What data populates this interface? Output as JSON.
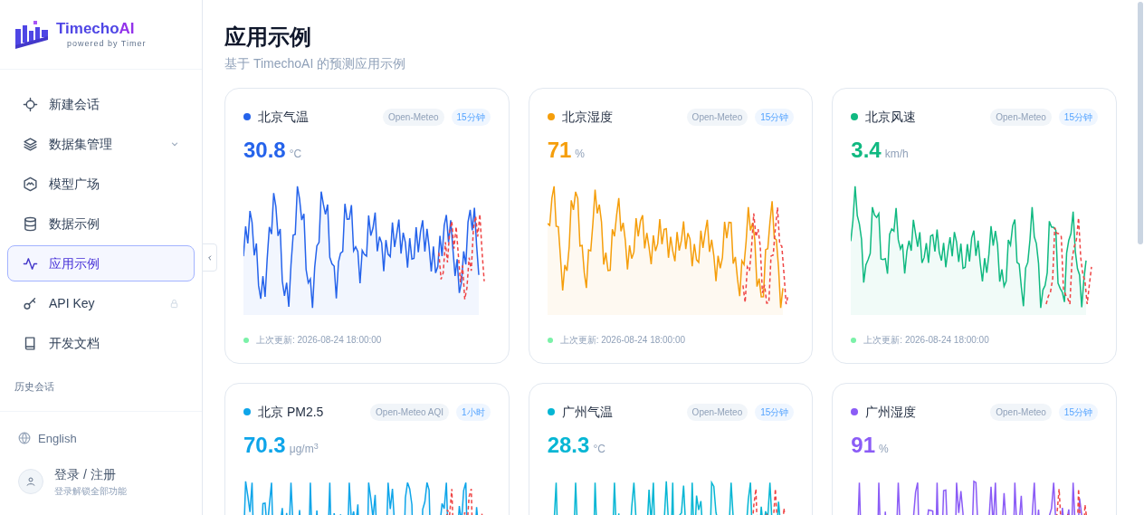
{
  "brand": {
    "name_main": "Timecho",
    "name_accent": "AI",
    "tagline": "powered by Timer"
  },
  "sidebar": {
    "items": [
      {
        "label": "新建会话",
        "selected": false,
        "has_submenu": false,
        "locked": false
      },
      {
        "label": "数据集管理",
        "selected": false,
        "has_submenu": true,
        "locked": false
      },
      {
        "label": "模型广场",
        "selected": false,
        "has_submenu": false,
        "locked": false
      },
      {
        "label": "数据示例",
        "selected": false,
        "has_submenu": false,
        "locked": false
      },
      {
        "label": "应用示例",
        "selected": true,
        "has_submenu": false,
        "locked": false
      },
      {
        "label": "API Key",
        "selected": false,
        "has_submenu": false,
        "locked": true
      },
      {
        "label": "开发文档",
        "selected": false,
        "has_submenu": false,
        "locked": false
      }
    ],
    "history_heading": "历史会话",
    "language": "English",
    "login": {
      "title": "登录 / 注册",
      "subtitle": "登录解锁全部功能"
    }
  },
  "page": {
    "title": "应用示例",
    "subtitle": "基于 TimechoAI 的预测应用示例"
  },
  "cards": [
    {
      "title": "北京气温",
      "color": "#2563eb",
      "source": "Open-Meteo",
      "interval": "15分钟",
      "value": "30.8",
      "unit": "°C",
      "updated": "上次更新: 2026-08-24 18:00:00"
    },
    {
      "title": "北京湿度",
      "color": "#f59e0b",
      "source": "Open-Meteo",
      "interval": "15分钟",
      "value": "71",
      "unit": "%",
      "updated": "上次更新: 2026-08-24 18:00:00"
    },
    {
      "title": "北京风速",
      "color": "#10b981",
      "source": "Open-Meteo",
      "interval": "15分钟",
      "value": "3.4",
      "unit": "km/h",
      "updated": "上次更新: 2026-08-24 18:00:00"
    },
    {
      "title": "北京 PM2.5",
      "color": "#0ea5e9",
      "source": "Open-Meteo AQI",
      "interval": "1小时",
      "value": "70.3",
      "unit": "μg/m$^{3}$"
    },
    {
      "title": "广州气温",
      "color": "#06b6d4",
      "source": "Open-Meteo",
      "interval": "15分钟",
      "value": "28.3",
      "unit": "°C"
    },
    {
      "title": "广州湿度",
      "color": "#8b5cf6",
      "source": "Open-Meteo",
      "interval": "15分钟",
      "value": "91",
      "unit": "%"
    }
  ]
}
